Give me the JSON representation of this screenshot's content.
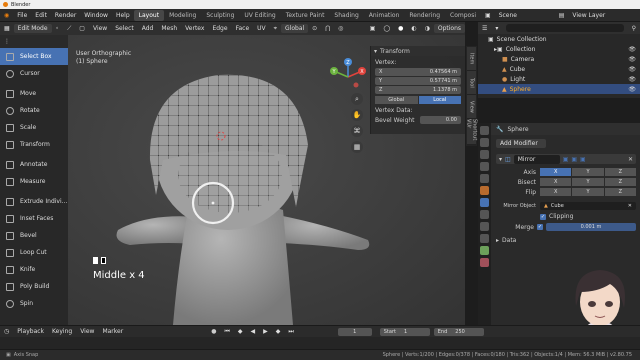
{
  "window": {
    "title": "Blender"
  },
  "menu": {
    "items": [
      "File",
      "Edit",
      "Render",
      "Window",
      "Help"
    ],
    "workspaces": [
      "Layout",
      "Modeling",
      "Sculpting",
      "UV Editing",
      "Texture Paint",
      "Shading",
      "Animation",
      "Rendering",
      "Composi"
    ],
    "active_workspace": "Layout",
    "scene": "Scene",
    "view_layer": "View Layer"
  },
  "viewport_header": {
    "mode": "Edit Mode",
    "menus": [
      "View",
      "Select",
      "Add",
      "Mesh",
      "Vertex",
      "Edge",
      "Face",
      "UV"
    ],
    "orientation": "Global",
    "options": "Options"
  },
  "viewport": {
    "view_name": "User Orthographic",
    "object_name": "(1) Sphere",
    "overlay_text": "Middle x 4",
    "gizmo_axes": [
      "X",
      "Y",
      "Z"
    ]
  },
  "toolbar": {
    "tools": [
      {
        "label": "Select Box",
        "active": true
      },
      {
        "label": "Cursor"
      },
      {
        "label": "Move"
      },
      {
        "label": "Rotate"
      },
      {
        "label": "Scale"
      },
      {
        "label": "Transform"
      },
      {
        "label": "Annotate"
      },
      {
        "label": "Measure"
      },
      {
        "label": "Extrude Indivi..."
      },
      {
        "label": "Inset Faces"
      },
      {
        "label": "Bevel"
      },
      {
        "label": "Loop Cut"
      },
      {
        "label": "Knife"
      },
      {
        "label": "Poly Build"
      },
      {
        "label": "Spin"
      }
    ]
  },
  "n_panel": {
    "title": "Transform",
    "vertex_label": "Vertex:",
    "x_label": "X",
    "x_value": "0.47564 m",
    "y_label": "Y",
    "y_value": "0.57741 m",
    "z_label": "Z",
    "z_value": "1.1378 m",
    "global_label": "Global",
    "local_label": "Local",
    "vertex_data_label": "Vertex Data:",
    "bevel_weight_label": "Bevel Weight",
    "bevel_weight_value": "0.00",
    "tabs": [
      "Item",
      "Tool",
      "View",
      "Shortcut VUr"
    ]
  },
  "outliner": {
    "collection_root": "Scene Collection",
    "items": [
      {
        "label": "Collection",
        "indent": 1
      },
      {
        "label": "Camera",
        "indent": 2
      },
      {
        "label": "Cube",
        "indent": 2
      },
      {
        "label": "Light",
        "indent": 2
      },
      {
        "label": "Sphere",
        "indent": 2,
        "selected": true
      }
    ]
  },
  "properties": {
    "object_name": "Sphere",
    "add_modifier": "Add Modifier",
    "modifier_name": "Mirror",
    "axis_label": "Axis",
    "bisect_label": "Bisect",
    "flip_label": "Flip",
    "axes": [
      "X",
      "Y",
      "Z"
    ],
    "mirror_object_label": "Mirror Object",
    "mirror_object_value": "Cube",
    "clipping_label": "Clipping",
    "merge_label": "Merge",
    "merge_value": "0.001 m",
    "data_label": "Data"
  },
  "timeline": {
    "menus": [
      "Playback",
      "Keying",
      "View",
      "Marker"
    ],
    "current_frame": "1",
    "start_label": "Start",
    "start_value": "1",
    "end_label": "End",
    "end_value": "250"
  },
  "status": {
    "left": "Axis Snap",
    "right": "Sphere | Verts:1/200 | Edges:0/378 | Faces:0/180 | Tris:362 | Objects:1/4 | Mem: 56.3 MiB | v2.80.75"
  },
  "colors": {
    "accent_blue": "#4772b3",
    "active_highlight": "#334d80",
    "axis_x": "#e0433c",
    "axis_y": "#6cb33f",
    "axis_z": "#4a8dd9",
    "mesh_grey": "#a8a8a8"
  }
}
